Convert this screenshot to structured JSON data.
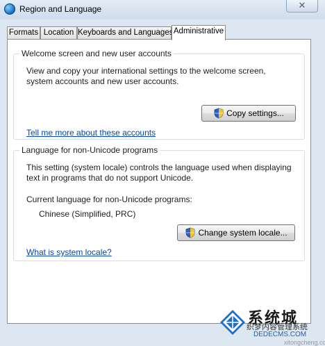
{
  "window": {
    "title": "Region and Language",
    "close_glyph": "✕"
  },
  "tabs": [
    {
      "label": "Formats"
    },
    {
      "label": "Location"
    },
    {
      "label": "Keyboards and Languages"
    },
    {
      "label": "Administrative",
      "active": true
    }
  ],
  "welcome": {
    "title": "Welcome screen and new user accounts",
    "description": "View and copy your international settings to the welcome screen, system accounts and new user accounts.",
    "copy_button": "Copy settings...",
    "link": "Tell me more about these accounts"
  },
  "non_unicode": {
    "title": "Language for non-Unicode programs",
    "description": "This setting (system locale) controls the language used when displaying text in programs that do not support Unicode.",
    "current_label": "Current language for non-Unicode programs:",
    "current_value": "Chinese (Simplified, PRC)",
    "change_button": "Change system locale...",
    "link": "What is system locale?"
  },
  "watermark": {
    "big_text": "系统城",
    "small_text": "xitongcheng.com",
    "cn_text": "织梦内容管理系统",
    "url": "DEDECMS.COM"
  },
  "icons": {
    "window_icon": "globe-icon",
    "uac": "shield-icon"
  }
}
